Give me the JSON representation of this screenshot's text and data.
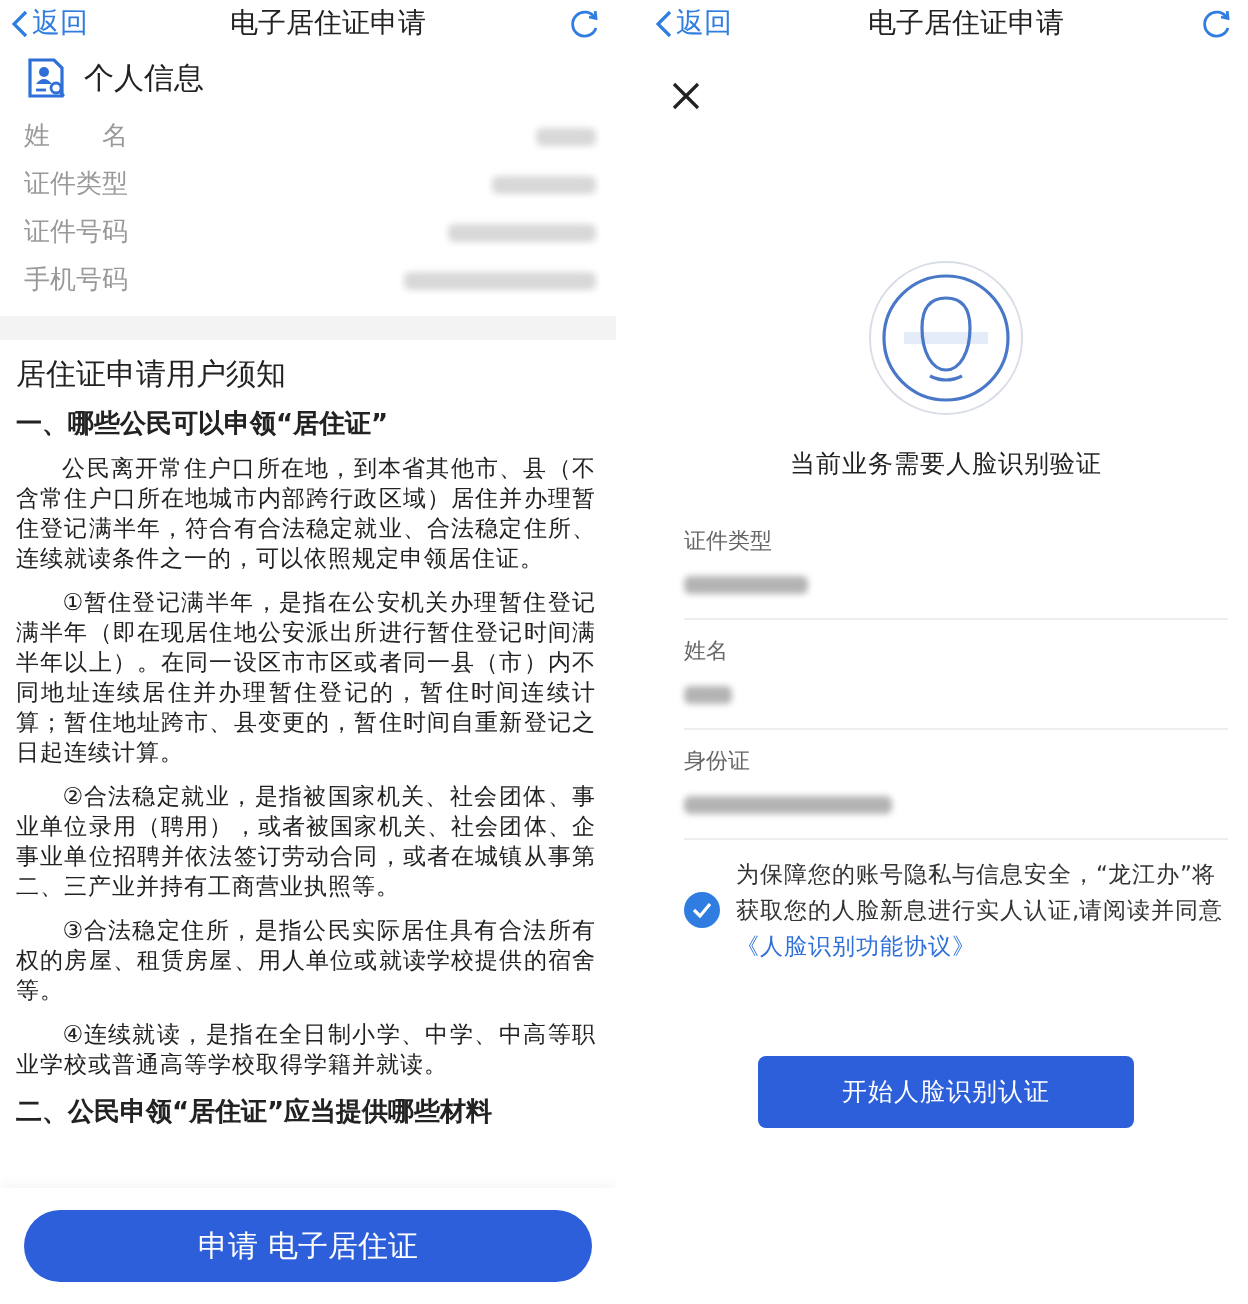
{
  "panels": [
    {
      "header": {
        "back": "返回",
        "title": "电子居住证申请"
      },
      "personal_info": {
        "title": "个人信息",
        "rows": [
          {
            "label": "姓　　名",
            "redacted": true
          },
          {
            "label": "证件类型",
            "redacted": true
          },
          {
            "label": "证件号码",
            "redacted": true
          },
          {
            "label": "手机号码",
            "redacted": true
          }
        ]
      },
      "notice": {
        "title": "居住证申请用户须知",
        "blocks": [
          {
            "kind": "heading",
            "text": "一、哪些公民可以申领“居住证”"
          },
          {
            "kind": "paragraph",
            "text": "公民离开常住户口所在地，到本省其他市、县（不含常住户口所在地城市内部跨行政区域）居住并办理暂住登记满半年，符合有合法稳定就业、合法稳定住所、连续就读条件之一的，可以依照规定申领居住证。"
          },
          {
            "kind": "paragraph",
            "text": "①暂住登记满半年，是指在公安机关办理暂住登记满半年（即在现居住地公安派出所进行暂住登记时间满半年以上）。在同一设区市市区或者同一县（市）内不同地址连续居住并办理暂住登记的，暂住时间连续计算；暂住地址跨市、县变更的，暂住时间自重新登记之日起连续计算。"
          },
          {
            "kind": "paragraph",
            "text": "②合法稳定就业，是指被国家机关、社会团体、事业单位录用（聘用），或者被国家机关、社会团体、企事业单位招聘并依法签订劳动合同，或者在城镇从事第二、三产业并持有工商营业执照等。"
          },
          {
            "kind": "paragraph",
            "text": "③合法稳定住所，是指公民实际居住具有合法所有权的房屋、租赁房屋、用人单位或就读学校提供的宿舍等。"
          },
          {
            "kind": "paragraph",
            "text": "④连续就读，是指在全日制小学、中学、中高等职业学校或普通高等学校取得学籍并就读。"
          },
          {
            "kind": "heading",
            "text": "二、公民申领“居住证”应当提供哪些材料"
          }
        ]
      },
      "apply_button": "申请 电子居住证"
    },
    {
      "header": {
        "back": "返回",
        "title": "电子居住证申请"
      },
      "face_prompt": "当前业务需要人脸识别验证",
      "fields": [
        {
          "label": "证件类型",
          "redacted": true
        },
        {
          "label": "姓名",
          "redacted": true
        },
        {
          "label": "身份证",
          "redacted": true
        }
      ],
      "consent": {
        "checked": true,
        "text": "为保障您的账号隐私与信息安全，“龙江办”将获取您的人脸新息进行实人认证,请阅读并同意",
        "link": "《人脸识别功能协议》"
      },
      "start_button": "开始人脸识别认证"
    }
  ]
}
